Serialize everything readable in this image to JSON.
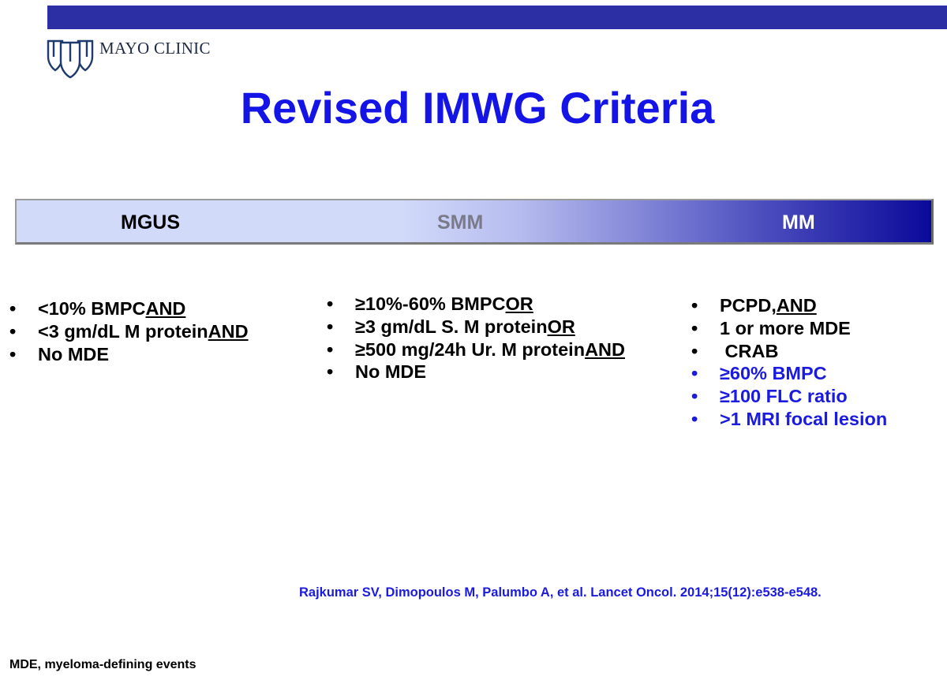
{
  "header": {
    "logo_text": "MAYO CLINIC",
    "bar_color": "#2c2ea4",
    "logo_icon": "mayo-shields-icon"
  },
  "title": "Revised IMWG Criteria",
  "spectrum": {
    "stages": [
      "MGUS",
      "SMM",
      "MM"
    ],
    "gradient_start": "#d2dafa",
    "gradient_end": "#0a0a9a"
  },
  "columns": {
    "mgus": {
      "items": [
        {
          "text": "<10% BMPC ",
          "emphasis": "AND "
        },
        {
          "text": "<3 gm/dL M protein ",
          "emphasis": "AND"
        },
        {
          "text": "No MDE",
          "emphasis": ""
        }
      ]
    },
    "smm": {
      "items": [
        {
          "text": "≥10%-60% BMPC ",
          "emphasis": "OR"
        },
        {
          "text": "≥3 gm/dL S. M protein ",
          "emphasis": "OR"
        },
        {
          "text": "≥500 mg/24h Ur. M protein ",
          "emphasis": "AND"
        },
        {
          "text": "No MDE",
          "emphasis": ""
        }
      ]
    },
    "mm": {
      "items": [
        {
          "text": "PCPD, ",
          "emphasis": "AND",
          "color": "black"
        },
        {
          "text": "1 or more MDE",
          "emphasis": "",
          "color": "black"
        },
        {
          "text": " CRAB",
          "emphasis": "",
          "color": "black"
        },
        {
          "text": "≥60% BMPC",
          "emphasis": "",
          "color": "blue"
        },
        {
          "text": "≥100 FLC ratio",
          "emphasis": "",
          "color": "blue"
        },
        {
          "text": ">1 MRI focal lesion",
          "emphasis": "",
          "color": "blue"
        }
      ]
    },
    "bullet": "•",
    "accent_color": "#1a1ae0"
  },
  "reference": "Rajkumar SV, Dimopoulos M, Palumbo A, et al. Lancet Oncol. 2014;15(12):e538-e548.",
  "footnote": "MDE, myeloma-defining events"
}
